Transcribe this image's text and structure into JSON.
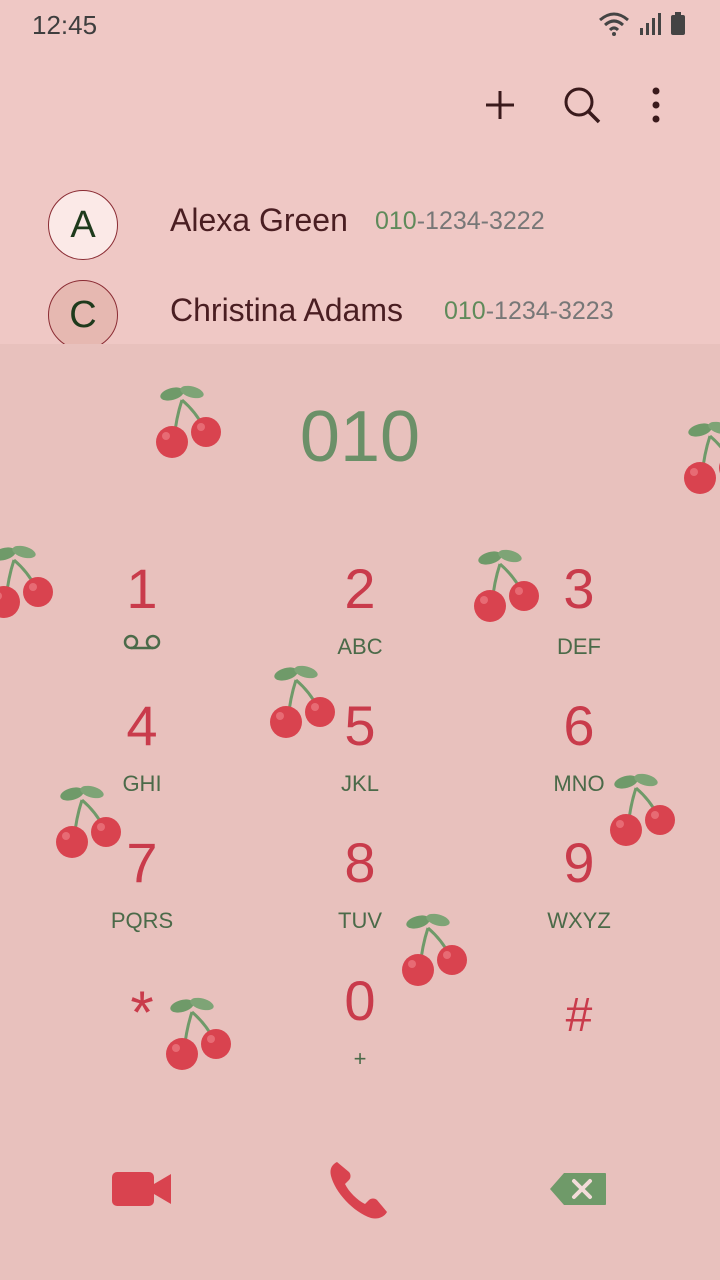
{
  "status_bar": {
    "time": "12:45",
    "icons": [
      "wifi-icon",
      "signal-icon",
      "battery-icon"
    ]
  },
  "toolbar": {
    "actions": [
      "add-icon",
      "search-icon",
      "more-options-icon"
    ]
  },
  "suggestions": [
    {
      "initial": "A",
      "name": "Alexa Green",
      "number_match": "010",
      "number_rest": "-1234-3222"
    },
    {
      "initial": "C",
      "name": "Christina Adams",
      "number_match": "010",
      "number_rest": "-1234-3223"
    }
  ],
  "dialer": {
    "input_number": "010",
    "keys": [
      {
        "digit": "1",
        "sub": "",
        "sub_icon": "voicemail-icon"
      },
      {
        "digit": "2",
        "sub": "ABC"
      },
      {
        "digit": "3",
        "sub": "DEF"
      },
      {
        "digit": "4",
        "sub": "GHI"
      },
      {
        "digit": "5",
        "sub": "JKL"
      },
      {
        "digit": "6",
        "sub": "MNO"
      },
      {
        "digit": "7",
        "sub": "PQRS"
      },
      {
        "digit": "8",
        "sub": "TUV"
      },
      {
        "digit": "9",
        "sub": "WXYZ"
      },
      {
        "digit": "*",
        "sub": ""
      },
      {
        "digit": "0",
        "sub": "+"
      },
      {
        "digit": "#",
        "sub": ""
      }
    ],
    "bottom_actions": [
      "video-call-icon",
      "phone-call-icon",
      "backspace-icon"
    ]
  },
  "colors": {
    "background": "#efc8c5",
    "dialpad_background": "#e8c1bd",
    "digit": "#c93b4b",
    "letters": "#4b6a49",
    "typed_number": "#6b9068",
    "cherry_red": "#d9434f",
    "leaf_green": "#6f9a69"
  }
}
